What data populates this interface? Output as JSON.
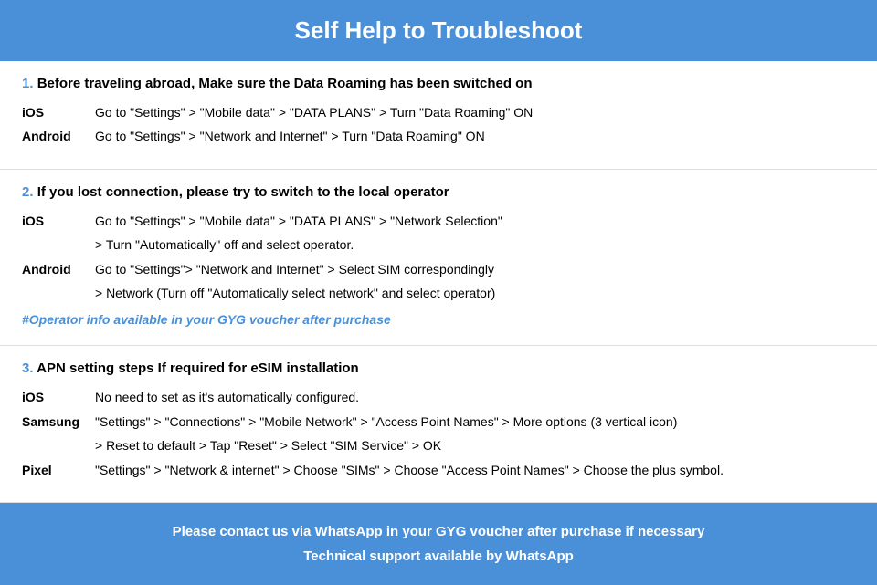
{
  "header": {
    "title": "Self Help to Troubleshoot"
  },
  "sections": [
    {
      "number": "1.",
      "title": "Before traveling abroad, Make sure the Data Roaming has been switched on",
      "items": [
        {
          "platform": "iOS",
          "text": "Go to \"Settings\" > \"Mobile data\" > \"DATA PLANS\" > Turn \"Data Roaming\" ON",
          "continuation": null
        },
        {
          "platform": "Android",
          "text": "Go to \"Settings\" > \"Network and Internet\" > Turn \"Data Roaming\" ON",
          "continuation": null
        }
      ],
      "note": null
    },
    {
      "number": "2.",
      "title": "If you lost connection, please try to switch to the local operator",
      "items": [
        {
          "platform": "iOS",
          "text": "Go to \"Settings\" > \"Mobile data\" > \"DATA PLANS\" > \"Network Selection\"",
          "continuation": "> Turn \"Automatically\" off and select operator."
        },
        {
          "platform": "Android",
          "text": "Go to \"Settings\">  \"Network and Internet\" > Select SIM correspondingly",
          "continuation": "> Network (Turn off \"Automatically select network\" and select operator)"
        }
      ],
      "note": "#Operator info available in your GYG voucher after purchase"
    },
    {
      "number": "3.",
      "title": "APN setting steps If required for eSIM installation",
      "items": [
        {
          "platform": "iOS",
          "text": "No need to set as it's automatically configured.",
          "continuation": null
        },
        {
          "platform": "Samsung",
          "text": "\"Settings\" > \"Connections\" > \"Mobile Network\" > \"Access Point Names\" > More options (3 vertical icon)",
          "continuation": "> Reset to default > Tap \"Reset\" > Select \"SIM Service\" > OK"
        },
        {
          "platform": "Pixel",
          "text": "\"Settings\" > \"Network & internet\" > Choose \"SIMs\" > Choose \"Access Point Names\" > Choose the plus symbol.",
          "continuation": null
        }
      ],
      "note": null
    }
  ],
  "footer": {
    "line1": "Please contact us via WhatsApp  in your GYG voucher after purchase if necessary",
    "line2": "Technical support available by WhatsApp"
  }
}
